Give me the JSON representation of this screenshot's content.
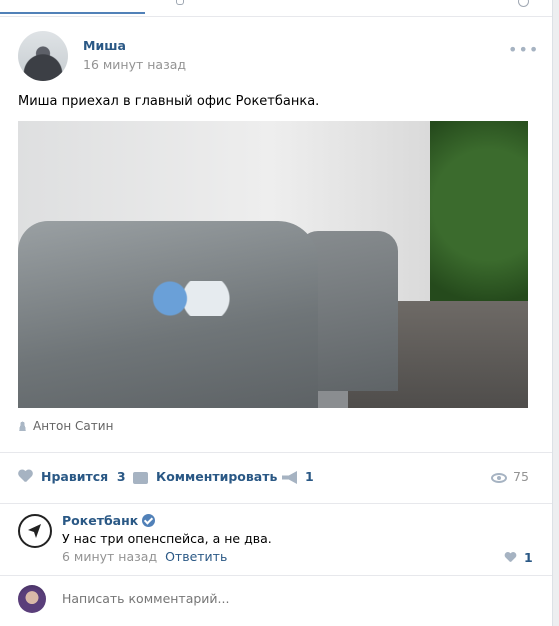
{
  "post": {
    "author": "Миша",
    "time": "16 минут назад",
    "text": "Миша приехал в главный офис Рокетбанка.",
    "photo_author": "Антон Сатин"
  },
  "actions": {
    "like_label": "Нравится",
    "like_count": "3",
    "comment_label": "Комментировать",
    "share_count": "1",
    "views": "75"
  },
  "comment": {
    "author": "Рокетбанк",
    "text": "У нас три опенспейса, а не два.",
    "time": "6 минут назад",
    "reply_label": "Ответить",
    "like_count": "1"
  },
  "reply_box": {
    "placeholder": "Написать комментарий..."
  },
  "colors": {
    "link": "#2a5885",
    "accent": "#5181b8",
    "muted": "#939393",
    "icon": "#a6b3c2"
  }
}
